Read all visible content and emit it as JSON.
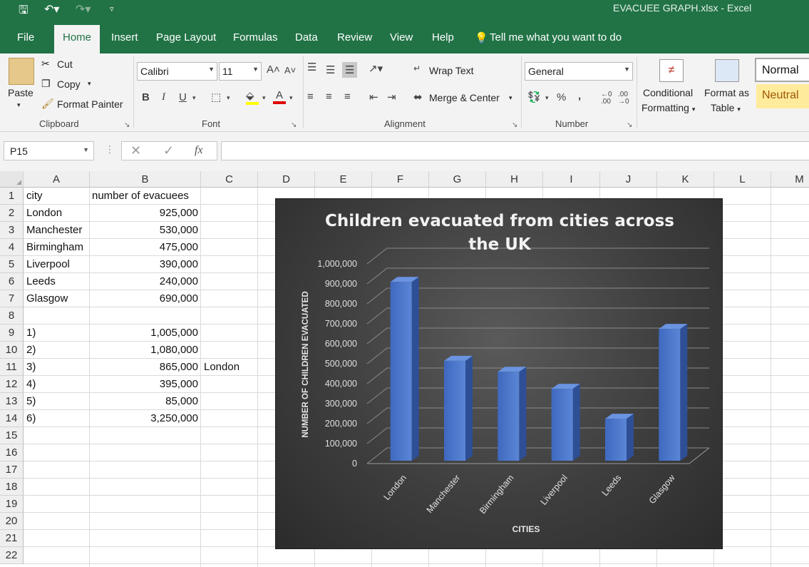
{
  "window": {
    "title": "EVACUEE GRAPH.xlsx  -  Excel"
  },
  "tabs": [
    "File",
    "Home",
    "Insert",
    "Page Layout",
    "Formulas",
    "Data",
    "Review",
    "View",
    "Help"
  ],
  "tell_me": "Tell me what you want to do",
  "ribbon": {
    "clipboard": {
      "paste": "Paste",
      "cut": "Cut",
      "copy": "Copy",
      "format_painter": "Format Painter",
      "label": "Clipboard"
    },
    "font": {
      "name": "Calibri",
      "size": "11",
      "bold": "B",
      "italic": "I",
      "underline": "U",
      "label": "Font"
    },
    "alignment": {
      "wrap_text": "Wrap Text",
      "merge_center": "Merge & Center",
      "label": "Alignment"
    },
    "number": {
      "format": "General",
      "percent": "%",
      "comma": ",",
      "label": "Number"
    },
    "styles": {
      "conditional": "Conditional",
      "formatting": "Formatting",
      "format_as": "Format as",
      "table": "Table",
      "normal": "Normal",
      "neutral": "Neutral"
    }
  },
  "formula_bar": {
    "name_box": "P15",
    "fx": "fx",
    "value": ""
  },
  "sheet": {
    "columns": [
      "A",
      "B",
      "C",
      "D",
      "E",
      "F",
      "G",
      "H",
      "I",
      "J",
      "K",
      "L",
      "M"
    ],
    "rows": [
      "1",
      "2",
      "3",
      "4",
      "5",
      "6",
      "7",
      "8",
      "9",
      "10",
      "11",
      "12",
      "13",
      "14",
      "15",
      "16",
      "17",
      "18",
      "19",
      "20",
      "21",
      "22"
    ],
    "cells": {
      "A1": "city",
      "B1": "number of evacuees",
      "A2": "London",
      "B2": "925,000",
      "A3": "Manchester",
      "B3": "530,000",
      "A4": "Birmingham",
      "B4": "475,000",
      "A5": "Liverpool",
      "B5": "390,000",
      "A6": "Leeds",
      "B6": "240,000",
      "A7": "Glasgow",
      "B7": "690,000",
      "A9": "1)",
      "B9": "1,005,000",
      "A10": "2)",
      "B10": "1,080,000",
      "A11": "3)",
      "B11": "865,000",
      "C11": "London",
      "A12": "4)",
      "B12": "395,000",
      "A13": "5)",
      "B13": "85,000",
      "A14": "6)",
      "B14": "3,250,000"
    }
  },
  "chart_data": {
    "type": "bar",
    "title": "Children evacuated from cities across the UK",
    "title_lines": [
      "Children evacuated from cities across",
      "the UK"
    ],
    "xlabel": "CITIES",
    "ylabel": "NUMBER OF CHILDREN EVACUATED",
    "categories": [
      "London",
      "Manchester",
      "Birmingham",
      "Liverpool",
      "Leeds",
      "Glasgow"
    ],
    "values": [
      925000,
      530000,
      475000,
      390000,
      240000,
      690000
    ],
    "ylim": [
      0,
      1000000
    ],
    "yticks": [
      0,
      100000,
      200000,
      300000,
      400000,
      500000,
      600000,
      700000,
      800000,
      900000,
      1000000
    ],
    "ytick_labels": [
      "0",
      "100,000",
      "200,000",
      "300,000",
      "400,000",
      "500,000",
      "600,000",
      "700,000",
      "800,000",
      "900,000",
      "1,000,000"
    ],
    "grid": true,
    "style": "3d-column",
    "bar_color": "#4472c4",
    "background_color": "#404040"
  }
}
